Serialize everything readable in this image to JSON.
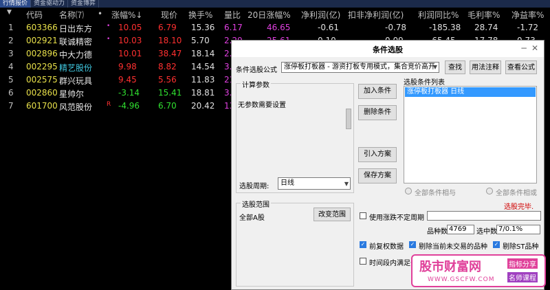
{
  "tabs": [
    "行情报价",
    "资金驱动力",
    "资金博弈"
  ],
  "header": [
    "代码",
    "名称⑺",
    "•",
    "涨幅%↓",
    "现价",
    "换手%",
    "量比",
    "20日涨幅%",
    "净利润(亿)",
    "扣非净利润(亿)",
    "利润同比%",
    "毛利率%",
    "净益率%"
  ],
  "rows": [
    {
      "i": "1",
      "code": "603366",
      "name": "日出东方",
      "flag": "•",
      "chg": "10.05",
      "price": "6.79",
      "turn": "15.36",
      "vr": "6.17",
      "d20": "46.65",
      "np": "-0.61",
      "nnp": "-0.78",
      "yoy": "-185.38",
      "gm": "28.74",
      "roe": "-1.72"
    },
    {
      "i": "2",
      "code": "002921",
      "name": "联诚精密",
      "flag": "•",
      "chg": "10.03",
      "price": "18.10",
      "turn": "5.70",
      "vr": "2.29",
      "d20": "25.61",
      "np": "0.10",
      "nnp": "0.09",
      "yoy": "-65.45",
      "gm": "17.78",
      "roe": "0.73"
    },
    {
      "i": "3",
      "code": "002896",
      "name": "中大力德",
      "flag": "",
      "chg": "10.01",
      "price": "38.47",
      "turn": "18.14",
      "vr": "2.",
      "d20": "",
      "np": "",
      "nnp": "",
      "yoy": "",
      "gm": "",
      "roe": ""
    },
    {
      "i": "4",
      "code": "002295",
      "name": "精艺股份",
      "flag": "",
      "chg": "9.98",
      "price": "8.82",
      "turn": "14.54",
      "vr": "3.",
      "d20": "",
      "np": "",
      "nnp": "",
      "yoy": "",
      "gm": "",
      "roe": ""
    },
    {
      "i": "5",
      "code": "002575",
      "name": "群兴玩具",
      "flag": "",
      "chg": "9.45",
      "price": "5.56",
      "turn": "11.83",
      "vr": "21",
      "d20": "",
      "np": "",
      "nnp": "",
      "yoy": "",
      "gm": "",
      "roe": ""
    },
    {
      "i": "6",
      "code": "002860",
      "name": "星帅尔",
      "flag": "",
      "chg": "-3.14",
      "price": "15.41",
      "turn": "18.81",
      "vr": "3.",
      "d20": "",
      "np": "",
      "nnp": "",
      "yoy": "",
      "gm": "",
      "roe": ""
    },
    {
      "i": "7",
      "code": "601700",
      "name": "风范股份",
      "flag": "R",
      "chg": "-4.96",
      "price": "6.70",
      "turn": "20.42",
      "vr": "13",
      "d20": "",
      "np": "",
      "nnp": "",
      "yoy": "",
      "gm": "",
      "roe": ""
    }
  ],
  "dialog": {
    "title": "条件选股",
    "formula_label": "条件选股公式",
    "formula_value": "涨停板打板器 - 游资打板专用模式，集合竞价高开",
    "btn_find": "查找",
    "btn_usage": "用法注释",
    "btn_view": "查看公式",
    "params_group": "计算参数",
    "params_text": "无参数需要设置",
    "period_label": "选股周期:",
    "period_value": "日线",
    "btn_add": "加入条件",
    "btn_delete": "删除条件",
    "btn_import": "引入方案",
    "btn_save": "保存方案",
    "cond_list_label": "选股条件列表",
    "cond_item": "涨停板打板器  日线",
    "radio_and": "全部条件相与",
    "radio_or": "全部条件相或",
    "status": "选股完毕.",
    "range_group": "选股范围",
    "range_value": "全部A股",
    "btn_range": "改变范围",
    "chk_uncertain": "使用涨跌不定周期",
    "count_label": "品种数",
    "count_value": "4769",
    "selected_label": "选中数",
    "selected_value": "7/0.1%",
    "chk_adjust": "前复权数据",
    "chk_remove_untraded": "剔除当前未交易的品种",
    "chk_remove_st": "剔除ST品种",
    "chk_period": "时间段内满足条"
  },
  "watermark": {
    "title": "股市财富网",
    "url": "WWW.GSCFW.COM",
    "tag1": "指标分享",
    "tag2": "名师课程"
  },
  "colors": {
    "rise": "#ff3030",
    "fall": "#30e030",
    "code": "#e8e04a",
    "select": "#3399ff",
    "watermark": "#e0409a"
  }
}
